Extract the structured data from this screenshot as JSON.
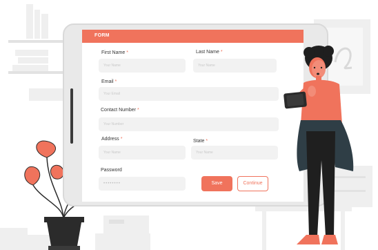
{
  "form": {
    "title": "FORM",
    "first_name": {
      "label": "First Name",
      "placeholder": "Your Name"
    },
    "last_name": {
      "label": "Last Name",
      "placeholder": "Your Name"
    },
    "email": {
      "label": "Email",
      "placeholder": "Your Email"
    },
    "contact_number": {
      "label": "Contact Number",
      "placeholder": "Your Number"
    },
    "address": {
      "label": "Address",
      "placeholder": "Your Name"
    },
    "state": {
      "label": "State",
      "placeholder": "Your Name"
    },
    "password": {
      "label": "Password",
      "value": "••••••••"
    },
    "required_mark": "*",
    "save_label": "Save",
    "continue_label": "Continue"
  },
  "colors": {
    "accent": "#f0735c",
    "field_bg": "#f2f2f2",
    "text": "#333333"
  },
  "illustration": {
    "icons": [
      "bookshelf-illustration",
      "potted-plant-illustration",
      "person-with-tablet-illustration",
      "boxes-illustration",
      "lamp-illustration"
    ]
  }
}
